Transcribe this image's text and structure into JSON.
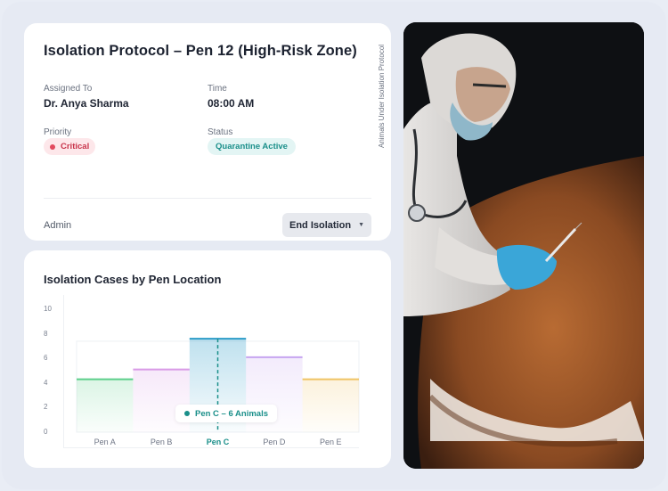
{
  "protocol": {
    "title": "Isolation Protocol – Pen 12 (High-Risk Zone)",
    "assigned_label": "Assigned To",
    "assigned_value": "Dr. Anya Sharma",
    "time_label": "Time",
    "time_value": "08:00 AM",
    "priority_label": "Priority",
    "priority_value": "Critical",
    "status_label": "Status",
    "status_value": "Quarantine Active",
    "role": "Admin",
    "action_button": "End Isolation"
  },
  "side_caption": "Animals Under Isolation Protocol",
  "colors": {
    "critical": "#c8334a",
    "status": "#1a8f8a",
    "pen_a": "#5ccf8a",
    "pen_b": "#d99ae6",
    "pen_c": "#2a9bc8",
    "pen_d": "#c7a5f0",
    "pen_e": "#f0c464"
  },
  "tooltip": "Pen C – 6 Animals",
  "chart_data": {
    "type": "bar",
    "title": "Isolation Cases by Pen Location",
    "categories": [
      "Pen A",
      "Pen B",
      "Pen C",
      "Pen D",
      "Pen E"
    ],
    "values": [
      4.3,
      5.1,
      7.6,
      6.1,
      4.3
    ],
    "active_category": "Pen C",
    "yticks": [
      0,
      2,
      4,
      6,
      8,
      10
    ],
    "ylim": [
      0,
      10
    ],
    "grid": false
  }
}
